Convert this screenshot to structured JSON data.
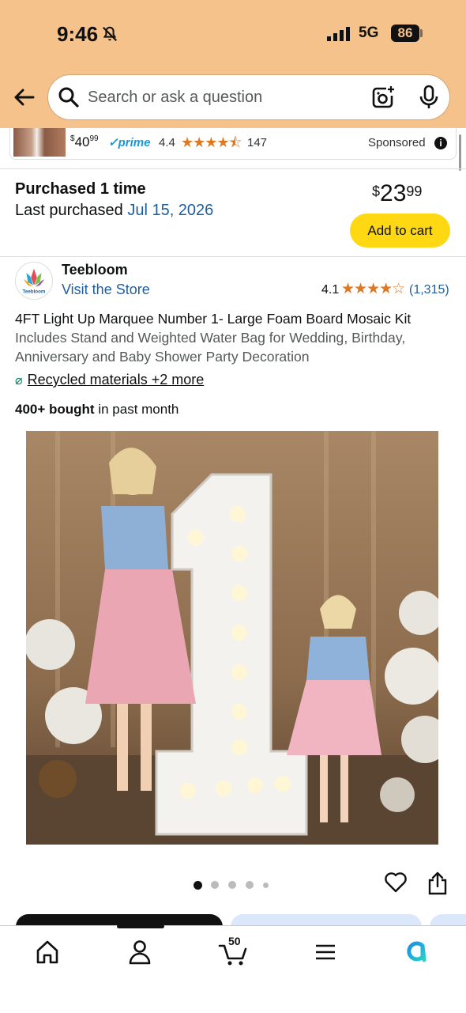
{
  "status_bar": {
    "time": "9:46",
    "network": "5G",
    "battery": "86"
  },
  "search": {
    "placeholder": "Search or ask a question"
  },
  "sponsored_ad": {
    "price_whole": "40",
    "price_cents": "99",
    "prime": "prime",
    "rating": "4.4",
    "stars": "★★★★⯪",
    "review_count": "147",
    "sponsored_label": "Sponsored"
  },
  "purchase": {
    "title": "Purchased 1 time",
    "last_label": "Last purchased",
    "last_date": "Jul 15, 2026",
    "price_currency": "$",
    "price_whole": "23",
    "price_cents": "99",
    "add_to_cart": "Add to cart"
  },
  "brand": {
    "name": "Teebloom",
    "visit_store": "Visit the Store",
    "logo_text": "Teebloom",
    "rating": "4.1",
    "stars": "★★★★☆",
    "rating_count": "(1,315)"
  },
  "product": {
    "title_main": "4FT Light Up Marquee Number 1- Large Foam Board Mosaic Kit",
    "title_sub": "Includes Stand and Weighted Water Bag for Wedding, Birthday, Anniversary and Baby Shower Party Decoration",
    "sustainability": "Recycled materials +2 more",
    "bought_bold": "400+ bought",
    "bought_rest": " in past month"
  },
  "gallery": {
    "image_count": 5,
    "active_index": 0
  },
  "bottom_nav": {
    "cart_count": "50"
  },
  "colors": {
    "header_bg": "#f4c28a",
    "link": "#1f5e9e",
    "cart_button": "#ffd814",
    "star": "#de7921"
  }
}
